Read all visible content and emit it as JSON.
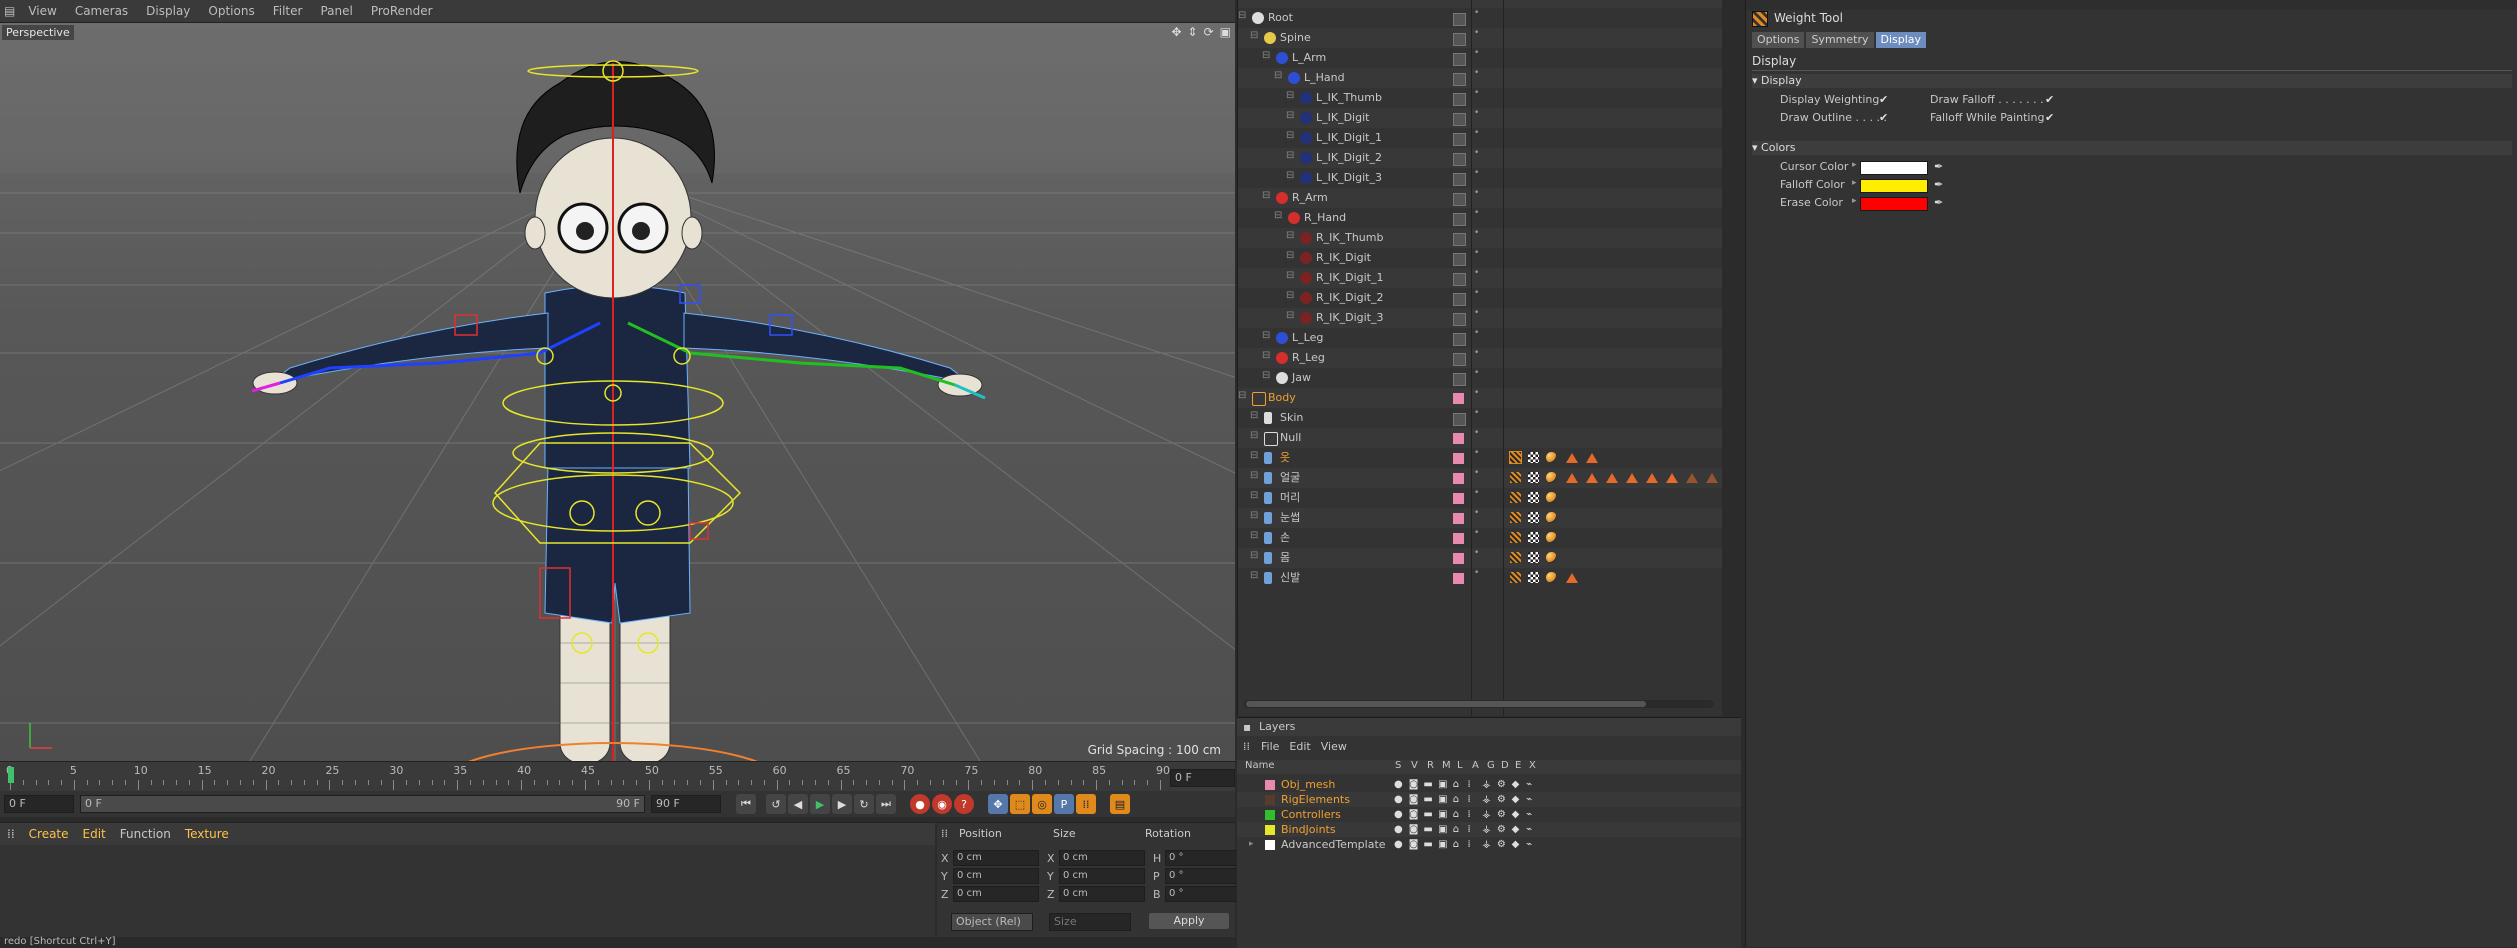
{
  "viewport": {
    "menu": [
      "View",
      "Cameras",
      "Display",
      "Options",
      "Filter",
      "Panel",
      "ProRender"
    ],
    "active_menus": [
      "View",
      "Cameras"
    ],
    "camera_label": "Perspective",
    "grid_spacing": "Grid Spacing : 100 cm"
  },
  "timeline": {
    "ticks": [
      "0",
      "5",
      "10",
      "15",
      "20",
      "25",
      "30",
      "35",
      "40",
      "45",
      "50",
      "55",
      "60",
      "65",
      "70",
      "75",
      "80",
      "85",
      "90"
    ],
    "current_frame_field": "0 F",
    "start_field": "0 F",
    "slider_start": "0 F",
    "slider_end": "90 F",
    "end_field": "90 F"
  },
  "material_manager": {
    "menu": [
      "Create",
      "Edit",
      "Function",
      "Texture"
    ]
  },
  "coordinates": {
    "headers": [
      "Position",
      "Size",
      "Rotation"
    ],
    "rows": [
      {
        "axis": "X",
        "position": "0 cm",
        "size_axis": "X",
        "size": "0 cm",
        "rot_axis": "H",
        "rotation": "0 °"
      },
      {
        "axis": "Y",
        "position": "0 cm",
        "size_axis": "Y",
        "size": "0 cm",
        "rot_axis": "P",
        "rotation": "0 °"
      },
      {
        "axis": "Z",
        "position": "0 cm",
        "size_axis": "Z",
        "size": "0 cm",
        "rot_axis": "B",
        "rotation": "0 °"
      }
    ],
    "mode": "Object (Rel)",
    "size_mode": "Size",
    "apply_label": "Apply"
  },
  "status_bar": "redo [Shortcut Ctrl+Y]",
  "object_manager": {
    "objects": [
      {
        "name": "Root",
        "depth": 0,
        "type": "joint",
        "color": "#dddddd"
      },
      {
        "name": "Spine",
        "depth": 1,
        "type": "spline",
        "color": "#e6c84a"
      },
      {
        "name": "L_Arm",
        "depth": 2,
        "type": "ctrl",
        "color": "#2d4fd6"
      },
      {
        "name": "L_Hand",
        "depth": 3,
        "type": "ctrl",
        "color": "#2d4fd6"
      },
      {
        "name": "L_IK_Thumb",
        "depth": 4,
        "type": "ctrl",
        "color": "#23307a"
      },
      {
        "name": "L_IK_Digit",
        "depth": 4,
        "type": "ctrl",
        "color": "#23307a"
      },
      {
        "name": "L_IK_Digit_1",
        "depth": 4,
        "type": "ctrl",
        "color": "#23307a"
      },
      {
        "name": "L_IK_Digit_2",
        "depth": 4,
        "type": "ctrl",
        "color": "#23307a"
      },
      {
        "name": "L_IK_Digit_3",
        "depth": 4,
        "type": "ctrl",
        "color": "#23307a"
      },
      {
        "name": "R_Arm",
        "depth": 2,
        "type": "ctrl",
        "color": "#d62d2d"
      },
      {
        "name": "R_Hand",
        "depth": 3,
        "type": "ctrl",
        "color": "#d62d2d"
      },
      {
        "name": "R_IK_Thumb",
        "depth": 4,
        "type": "ctrl",
        "color": "#7a2323"
      },
      {
        "name": "R_IK_Digit",
        "depth": 4,
        "type": "ctrl",
        "color": "#7a2323"
      },
      {
        "name": "R_IK_Digit_1",
        "depth": 4,
        "type": "ctrl",
        "color": "#7a2323"
      },
      {
        "name": "R_IK_Digit_2",
        "depth": 4,
        "type": "ctrl",
        "color": "#7a2323"
      },
      {
        "name": "R_IK_Digit_3",
        "depth": 4,
        "type": "ctrl",
        "color": "#7a2323"
      },
      {
        "name": "L_Leg",
        "depth": 2,
        "type": "ctrl",
        "color": "#2d4fd6"
      },
      {
        "name": "R_Leg",
        "depth": 2,
        "type": "ctrl",
        "color": "#d62d2d"
      },
      {
        "name": "Jaw",
        "depth": 2,
        "type": "joint",
        "color": "#dddddd"
      },
      {
        "name": "Body",
        "depth": 0,
        "type": "null",
        "color": "#f0a030",
        "orange": true
      },
      {
        "name": "Skin",
        "depth": 1,
        "type": "skin",
        "color": "#dddddd"
      },
      {
        "name": "Null",
        "depth": 1,
        "type": "null",
        "color": "#dddddd"
      },
      {
        "name": "옷",
        "depth": 1,
        "type": "mesh",
        "color": "#6fa0d8",
        "orange": true
      },
      {
        "name": "얼굴",
        "depth": 1,
        "type": "mesh",
        "color": "#6fa0d8"
      },
      {
        "name": "머리",
        "depth": 1,
        "type": "mesh",
        "color": "#6fa0d8"
      },
      {
        "name": "눈썹",
        "depth": 1,
        "type": "mesh",
        "color": "#6fa0d8"
      },
      {
        "name": "손",
        "depth": 1,
        "type": "mesh",
        "color": "#6fa0d8"
      },
      {
        "name": "몸",
        "depth": 1,
        "type": "mesh",
        "color": "#6fa0d8"
      },
      {
        "name": "신발",
        "depth": 1,
        "type": "mesh",
        "color": "#6fa0d8"
      }
    ],
    "mesh_tags": [
      {
        "row": 22,
        "triangles": [
          "solid",
          "solid"
        ]
      },
      {
        "row": 23,
        "triangles": [
          "solid",
          "solid",
          "solid",
          "solid",
          "solid",
          "solid",
          "outline",
          "outline",
          "outline"
        ]
      },
      {
        "row": 24,
        "triangles": []
      },
      {
        "row": 25,
        "triangles": []
      },
      {
        "row": 26,
        "triangles": []
      },
      {
        "row": 27,
        "triangles": []
      },
      {
        "row": 28,
        "triangles": [
          "solid"
        ]
      }
    ],
    "layer_color": "#e889b0"
  },
  "layers": {
    "title": "Layers",
    "menu": [
      "File",
      "Edit",
      "View"
    ],
    "headers": [
      "Name",
      "S",
      "V",
      "R",
      "M",
      "L",
      "A",
      "G",
      "D",
      "E",
      "X"
    ],
    "items": [
      {
        "name": "Obj_mesh",
        "color": "#e889b0",
        "text_color": "#f0a030"
      },
      {
        "name": "RigElements",
        "color": "#5a3a2a",
        "text_color": "#f0a030"
      },
      {
        "name": "Controllers",
        "color": "#2fbf2f",
        "text_color": "#f0a030"
      },
      {
        "name": "BindJoints",
        "color": "#e6e62a",
        "text_color": "#f0a030"
      },
      {
        "name": "AdvancedTemplate",
        "color": "#ffffff",
        "text_color": "#c8c8c8"
      }
    ]
  },
  "attributes": {
    "tool_name": "Weight Tool",
    "tabs": [
      "Options",
      "Symmetry",
      "Display"
    ],
    "active_tab": "Display",
    "header": "Display",
    "display_section": "Display",
    "display_options": [
      {
        "label": "Display Weighting",
        "checked": "✔"
      },
      {
        "label": "Draw Falloff . . . . . . .",
        "checked": "✔"
      },
      {
        "label": "Draw Outline . . . . .",
        "checked": "✔"
      },
      {
        "label": "Falloff While Painting",
        "checked": "✔"
      }
    ],
    "colors_section": "Colors",
    "colors": [
      {
        "label": "Cursor Color",
        "value": "#ffffff"
      },
      {
        "label": "Falloff Color",
        "value": "#ffee00"
      },
      {
        "label": "Erase Color",
        "value": "#ff0000"
      }
    ]
  }
}
